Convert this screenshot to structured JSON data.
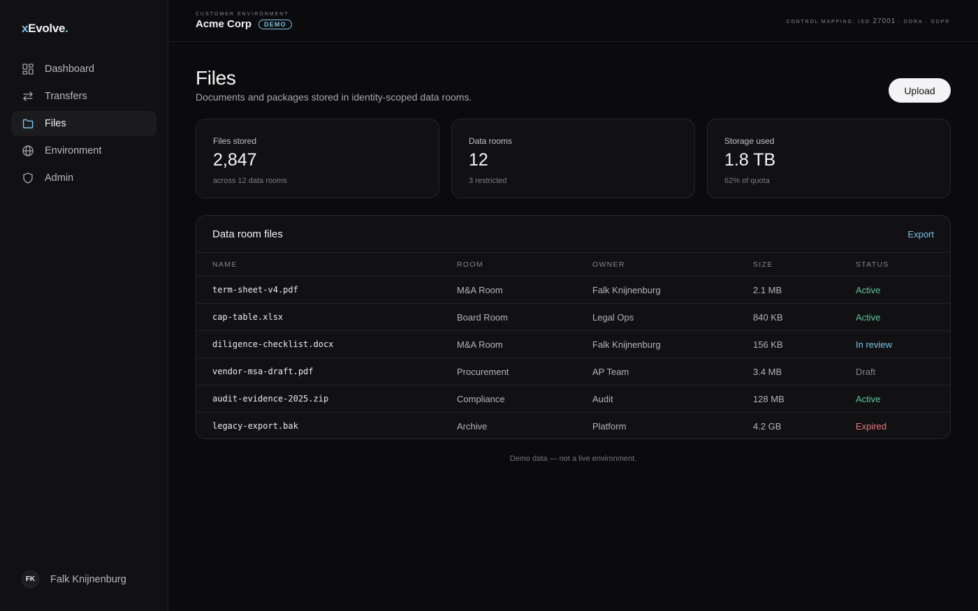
{
  "brand": {
    "prefix": "x",
    "name": "Evolve",
    "suffix": "."
  },
  "sidebar": {
    "items": [
      {
        "label": "Dashboard",
        "icon": "dashboard-icon"
      },
      {
        "label": "Transfers",
        "icon": "transfer-arrows-icon"
      },
      {
        "label": "Files",
        "icon": "folder-icon",
        "active": true
      },
      {
        "label": "Environment",
        "icon": "globe-icon"
      },
      {
        "label": "Admin",
        "icon": "shield-icon"
      }
    ],
    "user": {
      "initials": "FK",
      "name": "Falk Knijnenburg"
    }
  },
  "topbar": {
    "env_label": "CUSTOMER ENVIRONMENT",
    "org": "Acme Corp",
    "badge": "DEMO",
    "control_prefix": "CONTROL MAPPING: ISO",
    "control_num": "27001",
    "control_suffix": "· DORA · GDPR"
  },
  "page": {
    "title": "Files",
    "subtitle": "Documents and packages stored in identity-scoped data rooms.",
    "upload_label": "Upload"
  },
  "stats": [
    {
      "label": "Files stored",
      "value": "2,847",
      "note": "across 12 data rooms"
    },
    {
      "label": "Data rooms",
      "value": "12",
      "note": "3 restricted"
    },
    {
      "label": "Storage used",
      "value": "1.8 TB",
      "note": "62% of quota"
    }
  ],
  "table": {
    "title": "Data room files",
    "export_label": "Export",
    "columns": [
      "NAME",
      "ROOM",
      "OWNER",
      "SIZE",
      "STATUS"
    ],
    "rows": [
      {
        "name": "term-sheet-v4.pdf",
        "room": "M&A Room",
        "owner": "Falk Knijnenburg",
        "size": "2.1 MB",
        "status": "Active"
      },
      {
        "name": "cap-table.xlsx",
        "room": "Board Room",
        "owner": "Legal Ops",
        "size": "840 KB",
        "status": "Active"
      },
      {
        "name": "diligence-checklist.docx",
        "room": "M&A Room",
        "owner": "Falk Knijnenburg",
        "size": "156 KB",
        "status": "In review"
      },
      {
        "name": "vendor-msa-draft.pdf",
        "room": "Procurement",
        "owner": "AP Team",
        "size": "3.4 MB",
        "status": "Draft"
      },
      {
        "name": "audit-evidence-2025.zip",
        "room": "Compliance",
        "owner": "Audit",
        "size": "128 MB",
        "status": "Active"
      },
      {
        "name": "legacy-export.bak",
        "room": "Archive",
        "owner": "Platform",
        "size": "4.2 GB",
        "status": "Expired"
      }
    ]
  },
  "status_colors": {
    "Active": "#5ec49a",
    "In review": "#7cc4ea",
    "Draft": "#85858b",
    "Expired": "#ec7a7a"
  },
  "footnote": "Demo data — not a live environment."
}
